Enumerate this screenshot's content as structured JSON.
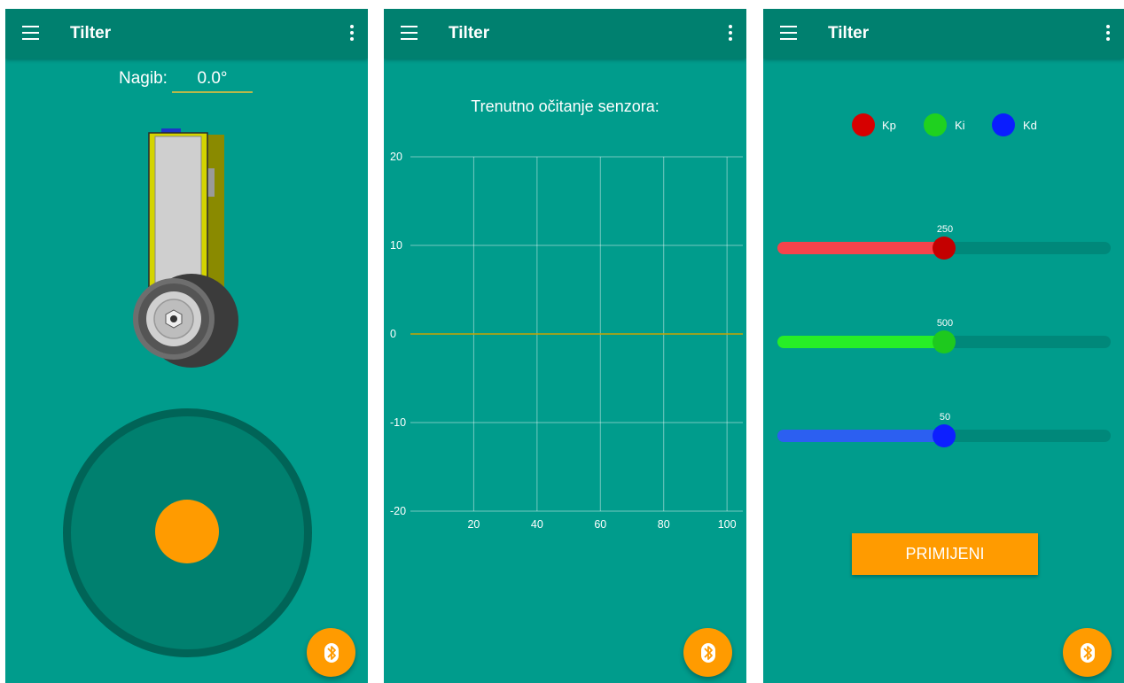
{
  "app": {
    "title": "Tilter"
  },
  "screen1": {
    "tilt_label": "Nagib:",
    "tilt_value": "0.0°"
  },
  "screen2": {
    "chart_data": {
      "type": "line",
      "title": "Trenutno očitanje senzora:",
      "xlabel": "",
      "ylabel": "",
      "x_ticks": [
        "20",
        "40",
        "60",
        "80",
        "100"
      ],
      "y_ticks": [
        "20",
        "10",
        "0",
        "-10",
        "-20"
      ],
      "xlim": [
        0,
        105
      ],
      "ylim": [
        -20,
        20
      ],
      "grid": true,
      "series": [
        {
          "color": "#c9a400",
          "x": [
            0,
            105
          ],
          "y": [
            0,
            0
          ]
        }
      ]
    }
  },
  "screen3": {
    "legend": [
      {
        "label": "Kp",
        "color": "#d60000"
      },
      {
        "label": "Ki",
        "color": "#1fd11f"
      },
      {
        "label": "Kd",
        "color": "#0a1dff"
      }
    ],
    "sliders": [
      {
        "name": "kp",
        "value": "250",
        "fraction": 0.5,
        "fill": "#f5434b",
        "thumb": "#c40000"
      },
      {
        "name": "ki",
        "value": "500",
        "fraction": 0.5,
        "fill": "#27ee27",
        "thumb": "#1ec91e"
      },
      {
        "name": "kd",
        "value": "50",
        "fraction": 0.5,
        "fill": "#2c5ff1",
        "thumb": "#0d1fff"
      }
    ],
    "apply_label": "PRIMIJENI"
  },
  "icons": {
    "menu": "menu-icon",
    "overflow": "more-vert-icon",
    "fab": "bluetooth-icon"
  },
  "colors": {
    "primary": "#009c8c",
    "primary_dark": "#00806f",
    "accent": "#ff9b00"
  }
}
